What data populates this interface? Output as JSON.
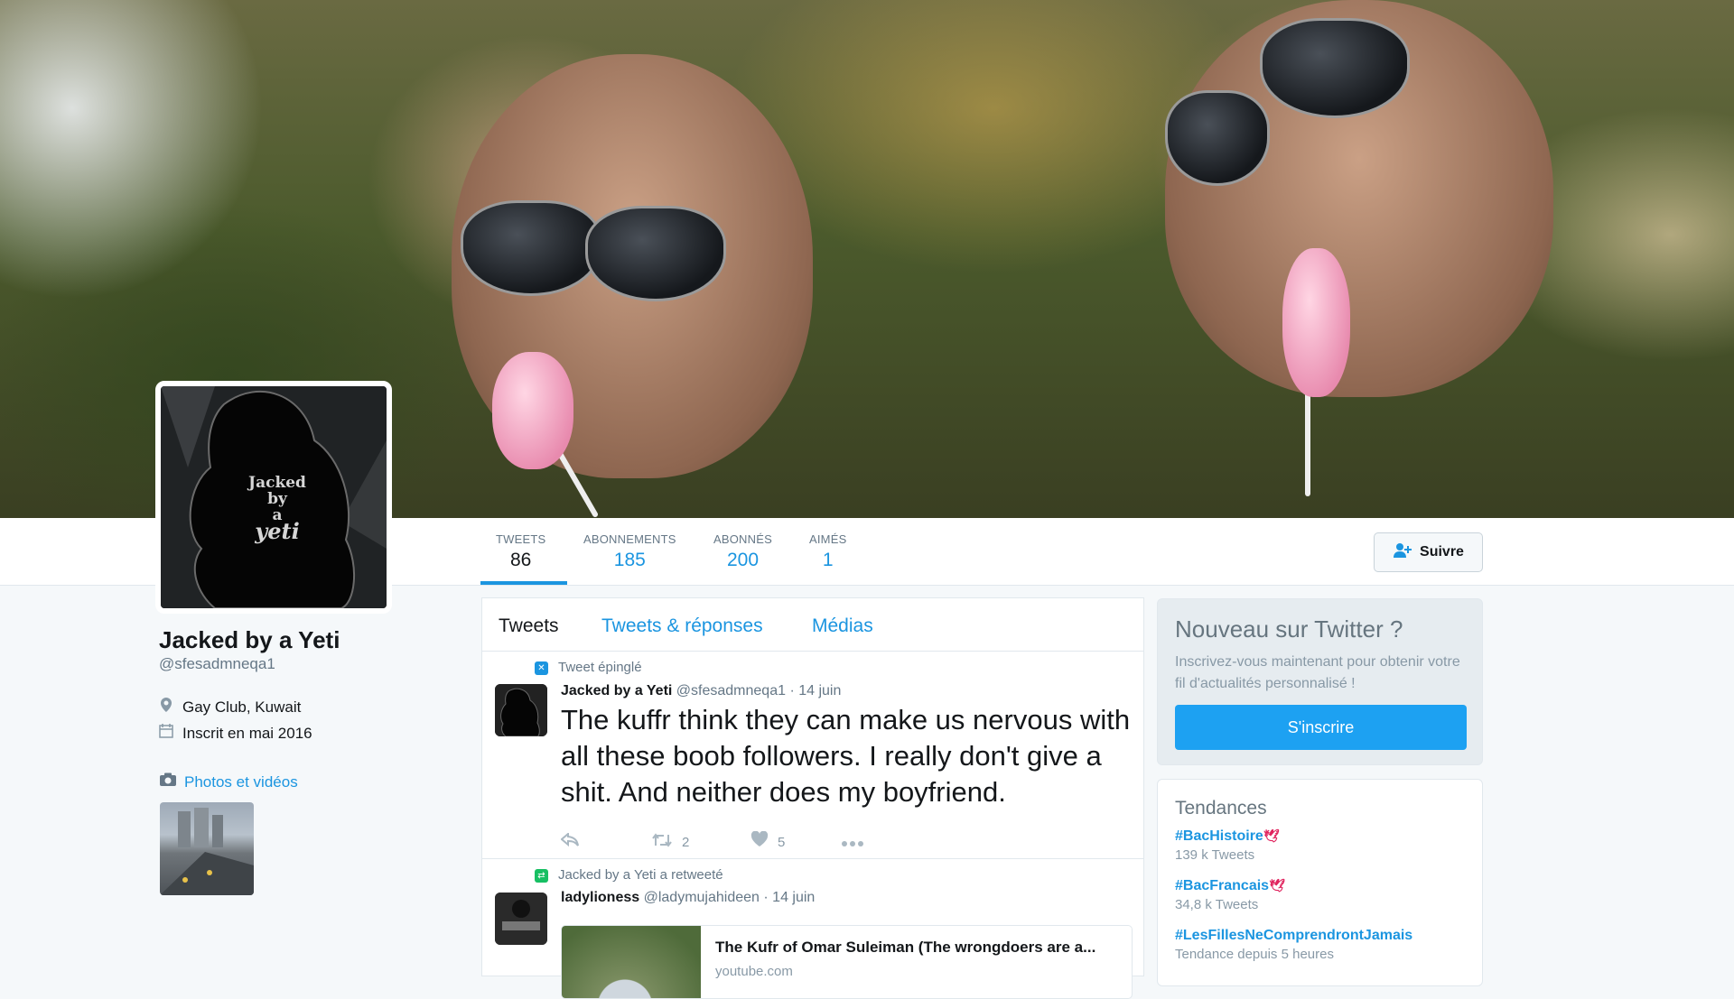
{
  "header": {
    "banner_desc": ""
  },
  "stats": [
    {
      "label": "TWEETS",
      "value": "86"
    },
    {
      "label": "ABONNEMENTS",
      "value": "185"
    },
    {
      "label": "ABONNÉS",
      "value": "200"
    },
    {
      "label": "AIMÉS",
      "value": "1"
    }
  ],
  "follow_button": {
    "label": "Suivre",
    "icon": "add-user-icon"
  },
  "profile": {
    "avatar_text_line1": "Jacked by",
    "avatar_text_line2": "a",
    "avatar_text_line3": "yeti",
    "name": "Jacked by a Yeti",
    "handle": "@sfesadmneqa1",
    "location": "Gay Club, Kuwait",
    "joined": "Inscrit en mai 2016",
    "photos_link": "Photos et vidéos"
  },
  "timeline": {
    "tabs": [
      "Tweets",
      "Tweets & réponses",
      "Médias"
    ],
    "tweets": [
      {
        "context": "Tweet épinglé",
        "name": "Jacked by a Yeti",
        "handle": "@sfesadmneqa1",
        "date": "· 14 juin",
        "text": "The kuffr think they can make us nervous with all these boob followers. I really don't give a shit. And neither does my boyfriend.",
        "retweets": "2",
        "likes": "5"
      },
      {
        "context": "Jacked by a Yeti a retweeté",
        "name": "ladylioness",
        "handle": "@ladymujahideen",
        "date": "· 14 juin",
        "card_title": "The Kufr of Omar Suleiman (The wrongdoers are a...",
        "card_url": "youtube.com"
      }
    ]
  },
  "sidebar": {
    "signup": {
      "title": "Nouveau sur Twitter ?",
      "desc": "Inscrivez-vous maintenant pour obtenir votre fil d'actualités personnalisé !",
      "button": "S'inscrire"
    },
    "trends": {
      "title": "Tendances",
      "items": [
        {
          "tag": "#BacHistoire",
          "sub": "139 k Tweets"
        },
        {
          "tag": "#BacFrancais",
          "sub": "34,8 k Tweets"
        },
        {
          "tag": "#LesFillesNeComprendrontJamais",
          "sub": "Tendance depuis 5 heures"
        }
      ]
    }
  },
  "colors": {
    "accent": "#1b95e0",
    "button": "#1da1f2",
    "text": "#14171a",
    "muted": "#657786"
  }
}
